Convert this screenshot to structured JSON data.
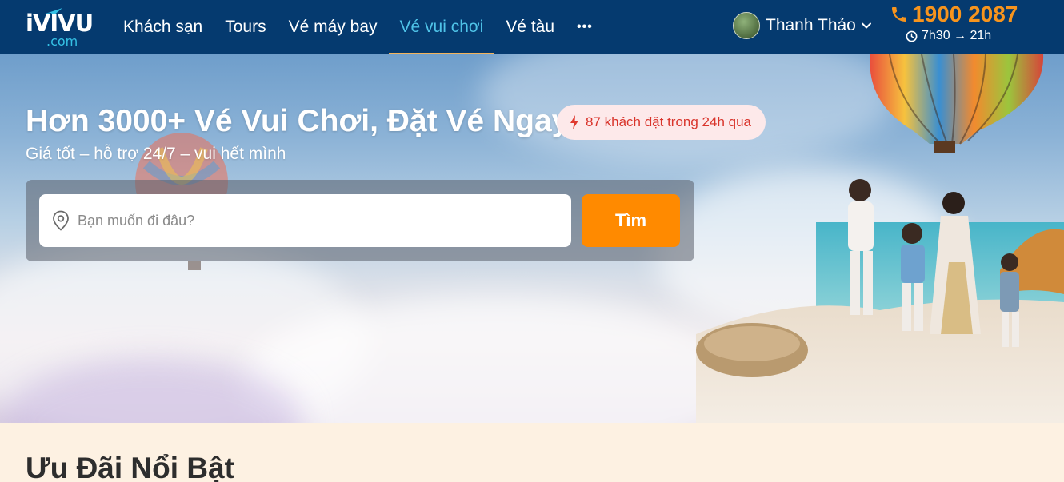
{
  "brand": {
    "logo_text": "iVIVU",
    "logo_sub": ".com",
    "accent_color": "#35C1E5",
    "header_bg": "#053A6F"
  },
  "nav": {
    "items": [
      {
        "label": "Khách sạn",
        "active": false
      },
      {
        "label": "Tours",
        "active": false
      },
      {
        "label": "Vé máy bay",
        "active": false
      },
      {
        "label": "Vé vui chơi",
        "active": true
      },
      {
        "label": "Vé tàu",
        "active": false
      }
    ],
    "more_label": "•••"
  },
  "user": {
    "name": "Thanh Thảo",
    "avatar_icon": "user-avatar"
  },
  "hotline": {
    "phone": "1900 2087",
    "hours": "7h30 → 21h",
    "phone_color": "#F7941D"
  },
  "hero": {
    "title": "Hơn 3000+ Vé Vui Chơi, Đặt Vé Ngay",
    "badge": "87 khách đặt trong 24h qua",
    "subtitle": "Giá tốt – hỗ trợ 24/7 – vui hết mình"
  },
  "search": {
    "placeholder": "Bạn muốn đi đâu?",
    "value": "",
    "button_label": "Tìm",
    "button_color": "#FF8A00"
  },
  "deals": {
    "title": "Ưu Đãi Nổi Bật"
  }
}
